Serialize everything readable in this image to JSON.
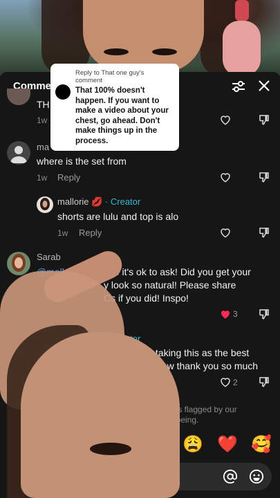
{
  "header": {
    "title": "Comments"
  },
  "tooltip": {
    "reply_to": "Reply to That one guy's comment",
    "text": "That 100% doesn't happen. If you want to make a video about your chest, go ahead. Don't make things up in the process."
  },
  "comments": [
    {
      "username": "",
      "text": "TH",
      "time": "1w",
      "reply": ""
    },
    {
      "username": "ma",
      "text": "where is the set from",
      "time": "1w",
      "reply": "Reply"
    },
    {
      "username": "mallorie 💋",
      "badge": "· Creator",
      "text": "shorts are lulu and top is alo",
      "time": "1w",
      "reply": "Reply"
    },
    {
      "username": "Sarab",
      "mention": "@mallorie 💋",
      "text1": "hope it's ok to ask! Did you get your",
      "text2": "y look so natural! Please share",
      "text3": "Cs if you did! Inspo!",
      "likes": "3"
    },
    {
      "badge": "Creator",
      "text1": "ut i'm taking this as the best",
      "text2": "ife wow thank you so much",
      "likes": "2"
    }
  ],
  "notice": {
    "line1": "others flagged by our",
    "line2": "well-being."
  },
  "emojis": [
    "😩",
    "❤️",
    "🥰"
  ],
  "colors": {
    "panel": "#161616",
    "creator": "#3bb6d0",
    "heart": "#fe2c55"
  }
}
